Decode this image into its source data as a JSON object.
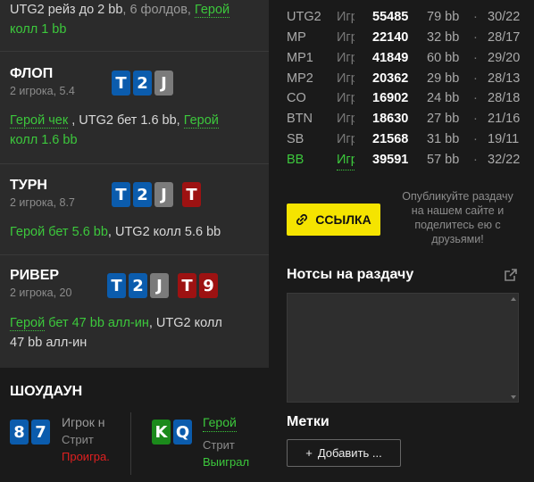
{
  "preflop_action": {
    "p1": "UTG2",
    "p2": " рейз до 2 bb",
    "p3": ", 6 фолдов, ",
    "hero": "Герой",
    "line2": "колл 1 bb"
  },
  "streets": [
    {
      "title": "ФЛОП",
      "sub": "2 игрока, 5.4",
      "cards": [
        {
          "rank": "T",
          "color": "#0b5cad"
        },
        {
          "rank": "2",
          "color": "#0b5cad"
        },
        {
          "rank": "J",
          "color": "#7b7b7b"
        }
      ],
      "action": {
        "a": "Герой чек",
        "b": " , UTG2 бет 1.6 bb, ",
        "c": "Герой",
        "d": "колл 1.6 bb"
      }
    },
    {
      "title": "ТУРН",
      "sub": "2 игрока, 8.7",
      "cards": [
        {
          "rank": "T",
          "color": "#0b5cad"
        },
        {
          "rank": "2",
          "color": "#0b5cad"
        },
        {
          "rank": "J",
          "color": "#7b7b7b"
        },
        {
          "rank": "T",
          "color": "#9d1212"
        }
      ],
      "action": {
        "a": "Герой бет 5.6 bb",
        "b": ", UTG2 колл 5.6 bb"
      }
    },
    {
      "title": "РИВЕР",
      "sub": "2 игрока, 20",
      "cards": [
        {
          "rank": "T",
          "color": "#0b5cad"
        },
        {
          "rank": "2",
          "color": "#0b5cad"
        },
        {
          "rank": "J",
          "color": "#7b7b7b"
        },
        {
          "rank": "T",
          "color": "#9d1212"
        },
        {
          "rank": "9",
          "color": "#9d1212"
        }
      ],
      "action": {
        "a": "Герой",
        "b": " бет 47 bb алл-ин",
        "c": ", UTG2 колл",
        "d": "47 bb алл-ин"
      }
    }
  ],
  "showdown": {
    "title": "ШОУДАУН",
    "players": [
      {
        "cards": [
          {
            "rank": "8",
            "color": "#0b5cad"
          },
          {
            "rank": "7",
            "color": "#0b5cad"
          }
        ],
        "name": "Игрок н",
        "street": "Стрит",
        "result": "Проигра."
      },
      {
        "cards": [
          {
            "rank": "K",
            "color": "#1b8a1b"
          },
          {
            "rank": "Q",
            "color": "#0b5cad"
          }
        ],
        "name": "Герой",
        "street": "Стрит",
        "result": "Выиграл"
      }
    ]
  },
  "stats": [
    {
      "pos": "UTG2",
      "type": "Игр",
      "hands": "55485",
      "bb": "79 bb",
      "ratio": "30/22",
      "hero": false
    },
    {
      "pos": "MP",
      "type": "Игр",
      "hands": "22140",
      "bb": "32 bb",
      "ratio": "28/17",
      "hero": false
    },
    {
      "pos": "MP1",
      "type": "Игр",
      "hands": "41849",
      "bb": "60 bb",
      "ratio": "29/20",
      "hero": false
    },
    {
      "pos": "MP2",
      "type": "Игр",
      "hands": "20362",
      "bb": "29 bb",
      "ratio": "28/13",
      "hero": false
    },
    {
      "pos": "CO",
      "type": "Игр",
      "hands": "16902",
      "bb": "24 bb",
      "ratio": "28/18",
      "hero": false
    },
    {
      "pos": "BTN",
      "type": "Игр",
      "hands": "18630",
      "bb": "27 bb",
      "ratio": "21/16",
      "hero": false
    },
    {
      "pos": "SB",
      "type": "Игр",
      "hands": "21568",
      "bb": "31 bb",
      "ratio": "19/11",
      "hero": false
    },
    {
      "pos": "BB",
      "type": "Игр",
      "hands": "39591",
      "bb": "57 bb",
      "ratio": "32/22",
      "hero": true
    }
  ],
  "stat_separator": "·",
  "link_button": {
    "label": "ССЫЛКА",
    "icon": "link-icon"
  },
  "share_text": "Опубликуйте раздачу на нашем сайте и поделитесь ею с друзьями!",
  "notes": {
    "title": "Нотсы на раздачу",
    "value": "",
    "icon": "external-link-icon"
  },
  "tags": {
    "title": "Метки",
    "add_label": "Добавить ...",
    "add_icon": "+"
  },
  "colors": {
    "accent_yellow": "#f5e400",
    "hero_green": "#3cc83c",
    "lose_red": "#e02020"
  }
}
